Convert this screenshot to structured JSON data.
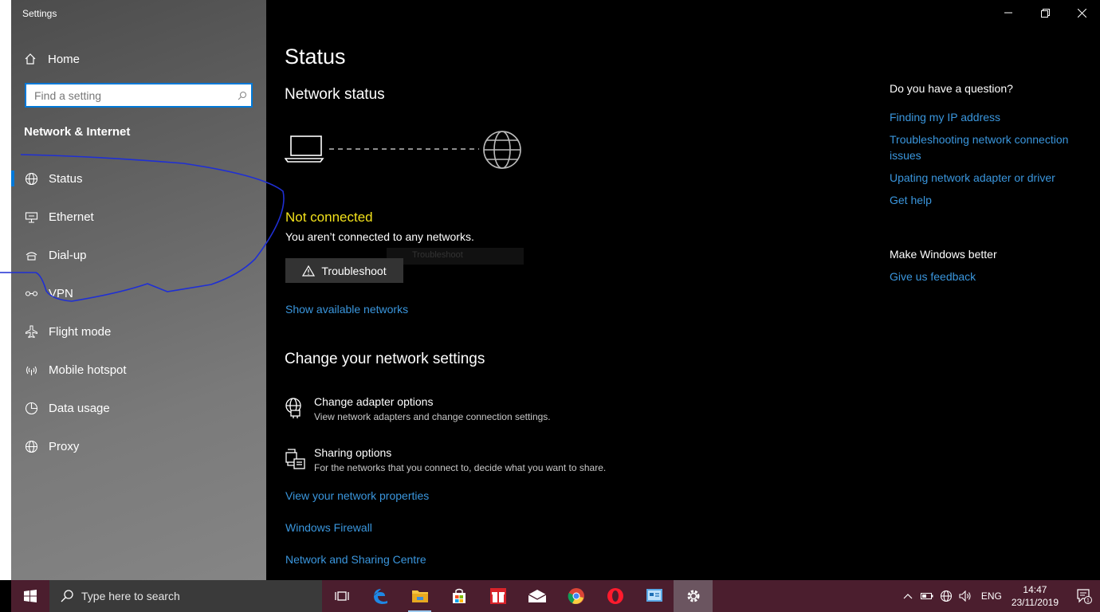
{
  "window": {
    "title": "Settings"
  },
  "sidebar": {
    "home_label": "Home",
    "search_placeholder": "Find a setting",
    "section_title": "Network & Internet",
    "items": [
      {
        "label": "Status",
        "icon": "globe-icon",
        "active": true
      },
      {
        "label": "Ethernet",
        "icon": "ethernet-icon"
      },
      {
        "label": "Dial-up",
        "icon": "dialup-icon"
      },
      {
        "label": "VPN",
        "icon": "vpn-icon"
      },
      {
        "label": "Flight mode",
        "icon": "airplane-icon"
      },
      {
        "label": "Mobile hotspot",
        "icon": "hotspot-icon"
      },
      {
        "label": "Data usage",
        "icon": "data-usage-icon"
      },
      {
        "label": "Proxy",
        "icon": "globe-icon"
      }
    ]
  },
  "main": {
    "title": "Status",
    "network_status_heading": "Network status",
    "connection_state": "Not connected",
    "connection_desc": "You aren’t connected to any networks.",
    "ghost_tooltip": "Troubleshoot",
    "troubleshoot_label": "Troubleshoot",
    "show_networks": "Show available networks",
    "change_heading": "Change your network settings",
    "options": [
      {
        "title": "Change adapter options",
        "subtitle": "View network adapters and change connection settings.",
        "icon": "adapter-icon"
      },
      {
        "title": "Sharing options",
        "subtitle": "For the networks that you connect to, decide what you want to share.",
        "icon": "sharing-icon"
      }
    ],
    "links": [
      "View your network properties",
      "Windows Firewall",
      "Network and Sharing Centre"
    ]
  },
  "side_panel": {
    "question_heading": "Do you have a question?",
    "question_links": [
      "Finding my IP address",
      "Troubleshooting network connection issues",
      "Upating network adapter or driver",
      "Get help"
    ],
    "better_heading": "Make Windows better",
    "feedback_link": "Give us feedback"
  },
  "taskbar": {
    "search_placeholder": "Type here to search",
    "apps": [
      "task-view",
      "edge",
      "file-explorer",
      "store",
      "gift-app",
      "mail",
      "chrome",
      "opera",
      "control-panel",
      "settings"
    ],
    "lang": "ENG",
    "time": "14:47",
    "date": "23/11/2019",
    "notification_count": "1"
  },
  "colors": {
    "accent": "#0078d7",
    "link": "#3a96dd",
    "warning": "#f3e21b",
    "taskbar": "#4b1e2e"
  }
}
